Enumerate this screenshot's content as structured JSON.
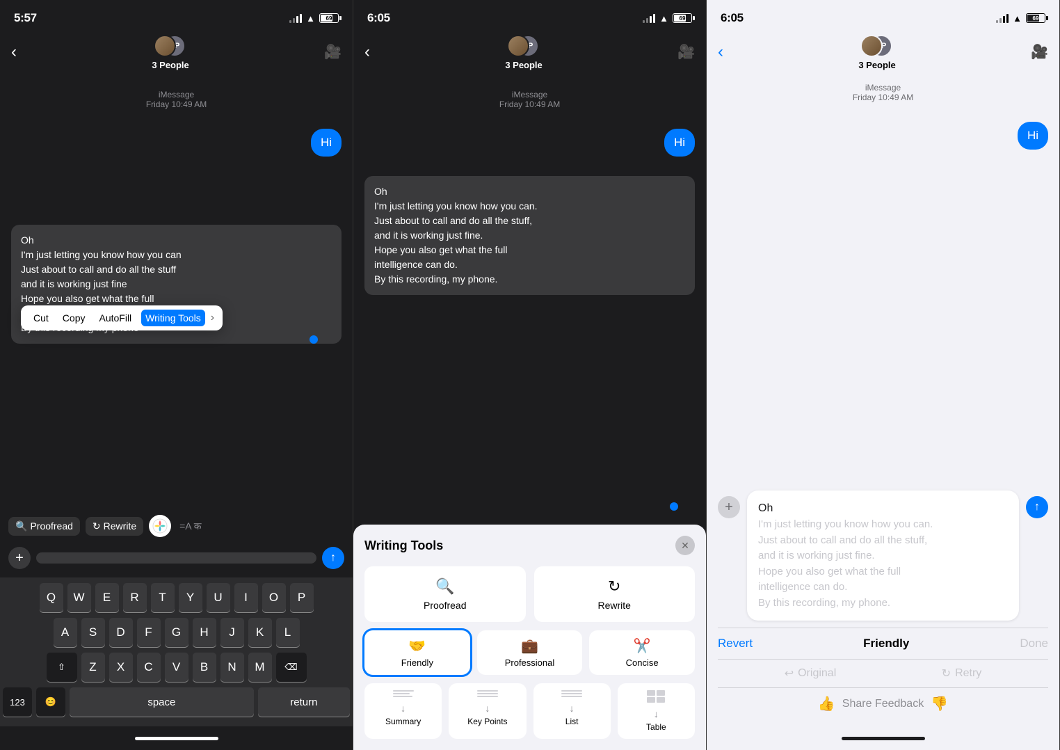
{
  "panels": [
    {
      "id": "panel1",
      "theme": "dark",
      "statusBar": {
        "time": "5:57",
        "signal": true,
        "wifi": true,
        "battery": "69"
      },
      "nav": {
        "backLabel": "‹",
        "groupLabel": "3 People",
        "videoIcon": "🎥"
      },
      "messages": {
        "imessageLabel": "iMessage",
        "dateLabel": "Friday 10:49 AM",
        "bubbleHi": "Hi",
        "inputText": "Oh\nI'm just letting you know how you can\nJust about to call and do all the stuff\nand it is working just fine\nHope you also get what the full\nintelligence can do\nBy this recording my phone"
      },
      "contextMenu": {
        "items": [
          "Cut",
          "Copy",
          "AutoFill",
          "Writing Tools"
        ],
        "activeItem": "Writing Tools",
        "hasChevron": true
      },
      "keyboardToolbar": {
        "proofread": "Proofread",
        "rewrite": "Rewrite",
        "aa": "=A  क"
      }
    },
    {
      "id": "panel2",
      "theme": "dark",
      "statusBar": {
        "time": "6:05",
        "signal": true,
        "wifi": true,
        "battery": "69"
      },
      "nav": {
        "backLabel": "‹",
        "groupLabel": "3 People",
        "videoIcon": "🎥"
      },
      "messages": {
        "imessageLabel": "iMessage",
        "dateLabel": "Friday 10:49 AM",
        "bubbleHi": "Hi",
        "inputText": "Oh\nI'm just letting you know how you can.\nJust about to call and do all the stuff,\nand it is working just fine.\nHope you also get what the full\nintelligence can do.\nBy this recording, my phone."
      },
      "writingTools": {
        "title": "Writing Tools",
        "closeIcon": "✕",
        "options": [
          {
            "icon": "🔍",
            "label": "Proofread"
          },
          {
            "icon": "↻",
            "label": "Rewrite"
          }
        ],
        "rewriteStyles": [
          {
            "icon": "🤝",
            "label": "Friendly",
            "active": true
          },
          {
            "icon": "💼",
            "label": "Professional"
          },
          {
            "icon": "✂️",
            "label": "Concise"
          }
        ],
        "summarizeOptions": [
          {
            "label": "Summary"
          },
          {
            "label": "Key Points"
          },
          {
            "label": "List"
          },
          {
            "label": "Table"
          }
        ]
      }
    },
    {
      "id": "panel3",
      "theme": "light",
      "statusBar": {
        "time": "6:05",
        "signal": true,
        "wifi": true,
        "battery": "69"
      },
      "nav": {
        "backLabel": "‹",
        "groupLabel": "3 People",
        "videoIcon": "🎥"
      },
      "messages": {
        "imessageLabel": "iMessage",
        "dateLabel": "Friday 10:49 AM",
        "bubbleHi": "Hi",
        "inputOriginal": "Oh",
        "inputSuggestion": "I'm just letting you know how you can.\nJust about to call and do all the stuff,\nand it is working just fine.\nHope you also get what the full\nintelligence can do.\nBy this recording, my phone."
      },
      "rewriteBar": {
        "revert": "Revert",
        "style": "Friendly",
        "done": "Done"
      },
      "origRetry": {
        "original": "Original",
        "retry": "Retry"
      },
      "feedback": {
        "label": "Share Feedback"
      }
    }
  ]
}
